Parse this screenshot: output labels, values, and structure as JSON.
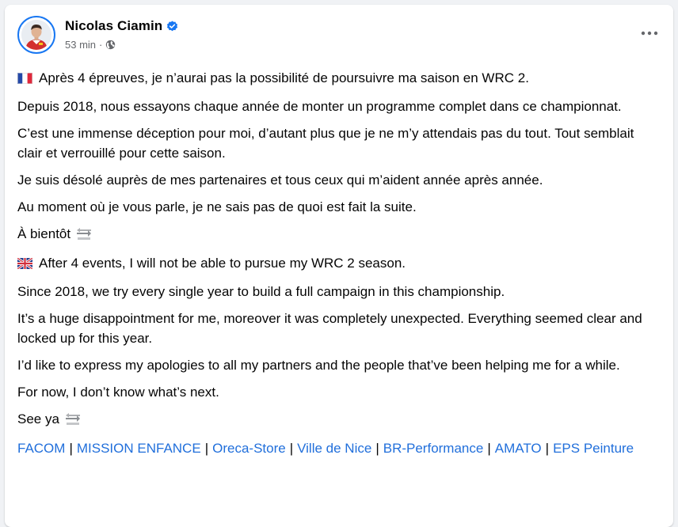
{
  "post": {
    "author": "Nicolas Ciamin",
    "time": "53 min",
    "meta_dot": "·",
    "icons": {
      "verified": "verified-badge-icon",
      "audience": "globe-icon",
      "more": "more-horizontal-icon",
      "flag_fr": "flag-france-icon",
      "flag_uk": "flag-uk-icon",
      "soon": "soon-arrow-icon"
    },
    "colors": {
      "link": "#216fdb",
      "verified": "#1877f2",
      "text": "#050505",
      "secondary": "#65676b"
    },
    "paragraphs_fr": [
      "Après 4 épreuves, je n’aurai pas la possibilité de poursuivre ma saison en WRC 2.",
      "Depuis 2018, nous essayons chaque année de monter un programme complet dans ce championnat.",
      "C’est une immense déception pour moi, d’autant plus que je ne m’y attendais pas du tout. Tout semblait clair et verrouillé pour cette saison.",
      "Je suis désolé auprès de mes partenaires et tous ceux qui m’aident année après année.",
      "Au moment où je vous parle, je ne sais pas de quoi est fait la suite.",
      "À bientôt"
    ],
    "paragraphs_en": [
      "After 4 events, I will not be able to pursue my WRC 2 season.",
      "Since 2018, we try every single year to build a full campaign in this championship.",
      "It’s a huge disappointment for me, moreover it was completely unexpected. Everything seemed clear and locked up for this year.",
      "I’d like to express my apologies to all my partners and the people that’ve been helping me for a while.",
      "For now, I don’t know what’s next.",
      "See ya"
    ],
    "links": [
      "FACOM",
      "MISSION ENFANCE",
      "Oreca-Store",
      "Ville de Nice",
      "BR-Performance",
      "AMATO",
      "EPS Peinture"
    ],
    "link_separator": "|"
  }
}
